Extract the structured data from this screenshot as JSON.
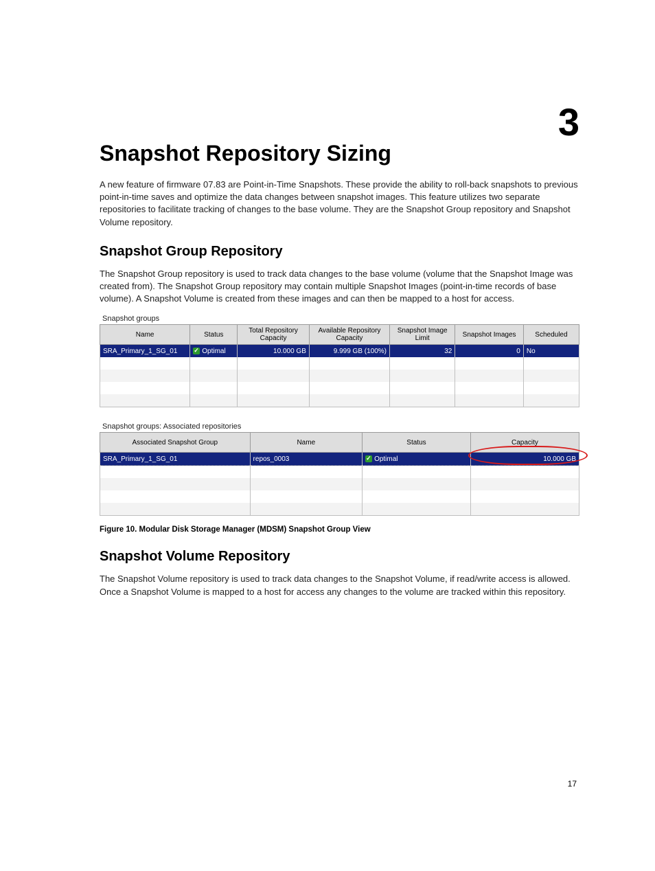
{
  "chapter_number": "3",
  "title": "Snapshot Repository Sizing",
  "intro_para": "A new feature of firmware 07.83 are Point-in-Time Snapshots. These provide the ability to roll-back snapshots to previous point-in-time saves and optimize the data changes between snapshot images. This feature utilizes two separate repositories to facilitate tracking of changes to the base volume. They are the Snapshot Group repository and Snapshot Volume repository.",
  "section1": {
    "heading": "Snapshot Group Repository",
    "para": "The Snapshot Group repository is used to track data changes to the base volume (volume that the Snapshot Image was created from). The Snapshot Group repository may contain multiple Snapshot Images (point-in-time records of base volume). A Snapshot Volume is created from these images and can then be mapped to a host for access."
  },
  "table1": {
    "label": "Snapshot groups",
    "headers": [
      "Name",
      "Status",
      "Total Repository Capacity",
      "Available Repository Capacity",
      "Snapshot Image Limit",
      "Snapshot Images",
      "Scheduled"
    ],
    "row": {
      "name": "SRA_Primary_1_SG_01",
      "status": "Optimal",
      "total_capacity": "10.000 GB",
      "available_capacity": "9.999 GB (100%)",
      "image_limit": "32",
      "images": "0",
      "scheduled": "No"
    }
  },
  "table2": {
    "label": "Snapshot groups: Associated repositories",
    "headers": [
      "Associated Snapshot Group",
      "Name",
      "Status",
      "Capacity"
    ],
    "row": {
      "group": "SRA_Primary_1_SG_01",
      "name": "repos_0003",
      "status": "Optimal",
      "capacity": "10.000 GB"
    }
  },
  "figure_caption": "Figure 10. Modular Disk Storage Manager (MDSM) Snapshot Group View",
  "section2": {
    "heading": "Snapshot Volume Repository",
    "para": "The Snapshot Volume repository is used to track data changes to the Snapshot Volume, if read/write access is allowed. Once a Snapshot Volume is mapped to a host for access any changes to the volume are tracked within this repository."
  },
  "page_number": "17"
}
